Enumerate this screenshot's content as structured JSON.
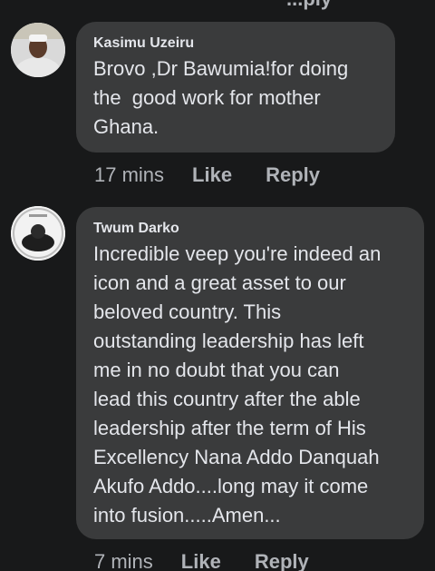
{
  "top_fragment": "...ply",
  "comments": [
    {
      "author": "Kasimu Uzeiru",
      "text": "Brovo ,Dr Bawumia!for doing\nthe  good work for mother\nGhana.",
      "time": "17 mins",
      "like_label": "Like",
      "reply_label": "Reply",
      "avatar_icon": "profile-photo-kasimu"
    },
    {
      "author": "Twum Darko",
      "text": "Incredible veep you're indeed an\nicon and a great asset to our\nbeloved country. This\noutstanding leadership has left\nme in no doubt that you can\nlead this country after the able\nleadership after the term of His\nExcellency Nana Addo Danquah\nAkufo Addo....long may it come\ninto fusion.....Amen...",
      "time": "7 mins",
      "like_label": "Like",
      "reply_label": "Reply",
      "avatar_icon": "profile-photo-twum"
    }
  ],
  "colors": {
    "background": "#18191a",
    "bubble": "#3a3b3c",
    "primary_text": "#e4e6eb",
    "secondary_text": "#b0b3b8"
  }
}
